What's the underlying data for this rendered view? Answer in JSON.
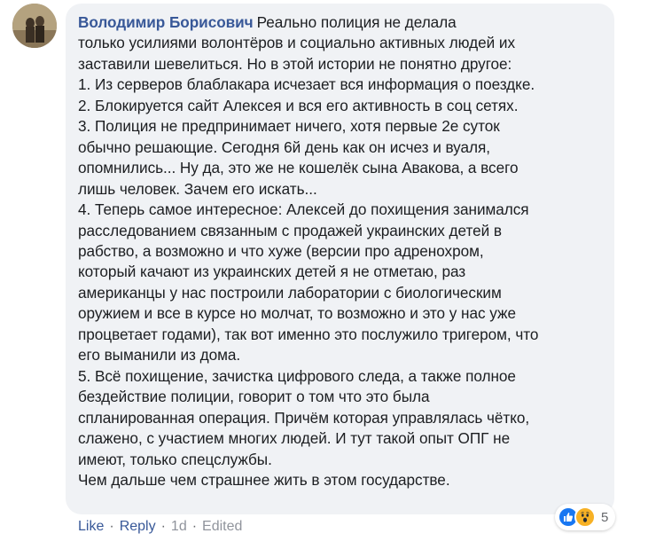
{
  "comment": {
    "author": "Володимир Борисович",
    "lines": [
      "Реально полиция не делала",
      "только усилиями волонтёров и социально активных людей их",
      "заставили шевелиться. Но в этой истории не понятно другое:",
      "1. Из серверов блаблакара исчезает вся информация о поездке.",
      "2. Блокируется сайт Алексея и вся его активность в соц сетях.",
      "3. Полиция не предпринимает ничего, хотя первые 2е суток",
      "обычно решающие. Сегодня 6й день как он исчез и вуаля,",
      "опомнились... Ну да, это же не кошелёк сына Авакова, а всего",
      "лишь человек. Зачем его искать...",
      "4. Теперь самое интересное: Алексей до похищения занимался",
      "расследованием связанным с продажей украинских детей в",
      "рабство, а возможно и что хуже (версии про адренохром,",
      "который качают из украинских детей я не отметаю, раз",
      "американцы у нас построили лаборатории с биологическим",
      "оружием и все в курсе но молчат, то возможно и это у нас уже",
      "процветает годами), так вот именно это послужило тригером, что",
      "его выманили из дома.",
      "5. Всё похищение, зачистка цифрового следа, а также полное",
      "бездействие полиции, говорит о том что это была",
      "спланированная операция. Причём которая управлялась чётко,",
      "слажено, с участием многих людей. И тут такой опыт ОПГ не",
      "имеют, только спецслужбы.",
      "Чем дальше чем страшнее жить в этом государстве."
    ]
  },
  "reactions": {
    "icons": [
      "like-icon",
      "wow-icon"
    ],
    "count": "5",
    "like_color": "#1877f2",
    "wow_color": "#f7b125"
  },
  "actions": {
    "like": "Like",
    "reply": "Reply",
    "time": "1d",
    "edited": "Edited",
    "separator": "·"
  }
}
